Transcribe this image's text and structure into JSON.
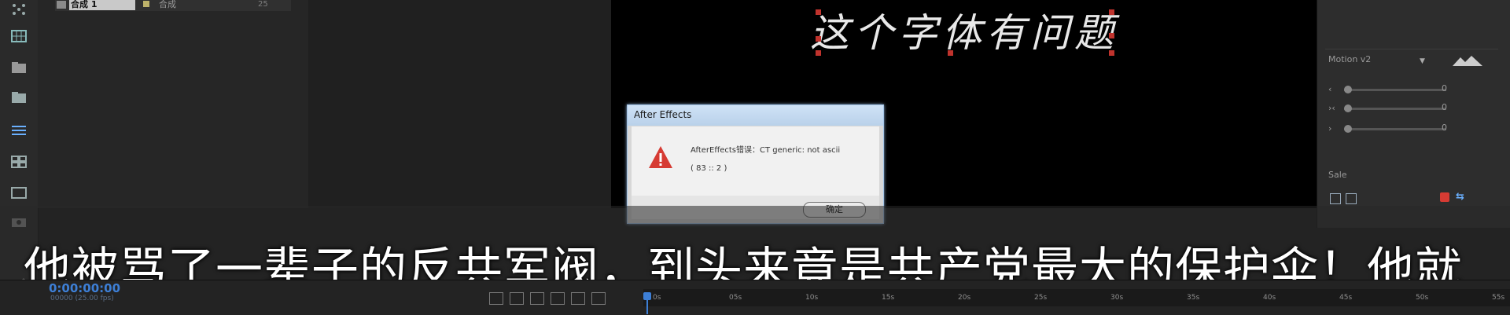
{
  "project": {
    "row_name": "合成 1",
    "row_type": "合成",
    "row_size": "25"
  },
  "composition": {
    "text": "这个字体有问题"
  },
  "dialog": {
    "title": "After Effects",
    "message": "AfterEffects错误：CT generic: not ascii",
    "code": "( 83 :: 2 )",
    "ok_label": "确定"
  },
  "effects_panel": {
    "preset_label": "Motion v2",
    "slider_values": [
      "0",
      "0",
      "0"
    ],
    "panel_label": "Sale"
  },
  "subtitle": {
    "text": "他被骂了一辈子的反共军阀，到头来竟是共产党最大的保护伞！他就"
  },
  "timeline": {
    "timecode": "0:00:00:00",
    "timecode_sub": "00000 (25.00 fps)",
    "ticks": [
      "0s",
      "05s",
      "10s",
      "15s",
      "20s",
      "25s",
      "30s",
      "35s",
      "40s",
      "45s",
      "50s",
      "55s"
    ]
  },
  "colors": {
    "accent": "#3d7fd6",
    "warning": "#d63b33",
    "selection_handle": "#c0332d"
  }
}
